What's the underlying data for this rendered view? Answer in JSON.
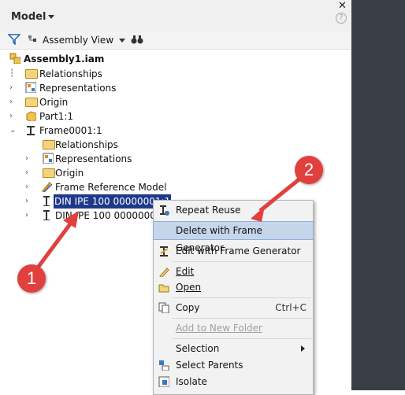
{
  "header": {
    "title": "Model",
    "close": "✕",
    "help": "?"
  },
  "toolbar": {
    "view_label": "Assembly View"
  },
  "tree": {
    "root": "Assembly1.iam",
    "items": [
      "Relationships",
      "Representations",
      "Origin",
      "Part1:1",
      "Frame0001:1",
      "Relationships",
      "Representations",
      "Origin",
      "Frame Reference Model",
      "DIN IPE 100 00000001:1",
      "DIN IPE 100 00000002"
    ]
  },
  "context_menu": {
    "items": [
      "Repeat Reuse",
      "Delete with Frame Generator",
      "Edit with Frame Generator",
      "Edit",
      "Open",
      "Copy",
      "Add to New Folder",
      "Selection",
      "Select Parents",
      "Isolate"
    ],
    "copy_shortcut": "Ctrl+C"
  },
  "callouts": [
    "1",
    "2"
  ],
  "colors": {
    "accent": "#e0403e",
    "selection": "#1d3a8a",
    "highlight": "#c5d5ea"
  }
}
